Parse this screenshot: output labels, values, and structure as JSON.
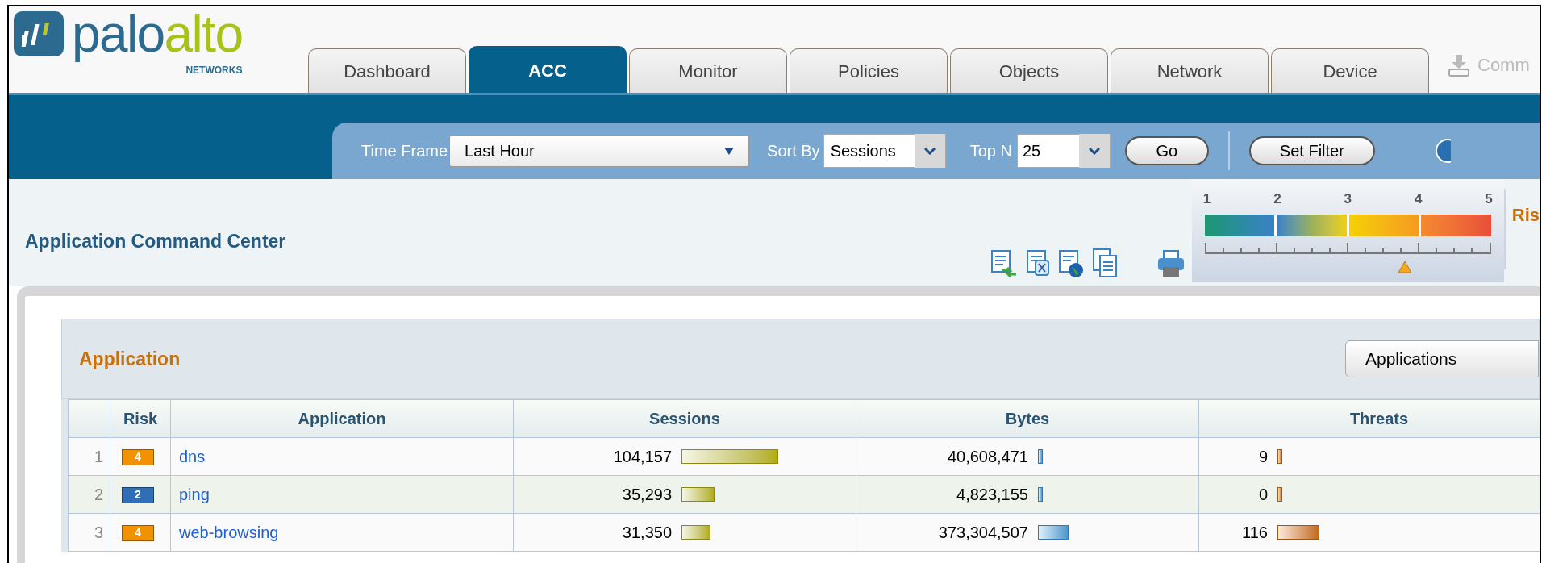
{
  "logo": {
    "word_1": "palo",
    "word_2": "alto",
    "subtitle": "NETWORKS"
  },
  "tabs": [
    {
      "label": "Dashboard",
      "selected": false
    },
    {
      "label": "ACC",
      "selected": true
    },
    {
      "label": "Monitor",
      "selected": false
    },
    {
      "label": "Policies",
      "selected": false
    },
    {
      "label": "Objects",
      "selected": false
    },
    {
      "label": "Network",
      "selected": false
    },
    {
      "label": "Device",
      "selected": false
    }
  ],
  "commit": {
    "label": "Comm"
  },
  "filters": {
    "time_frame": {
      "label": "Time Frame",
      "value": "Last Hour"
    },
    "sort_by": {
      "label": "Sort By",
      "value": "Sessions"
    },
    "top_n": {
      "label": "Top N",
      "value": "25"
    }
  },
  "buttons": [
    "Go",
    "Set Filter"
  ],
  "page_title": "Application Command Center",
  "risk_meter": {
    "labels": [
      "1",
      "2",
      "3",
      "4",
      "5"
    ],
    "level": 0.7,
    "title": "Ris"
  },
  "panel": {
    "title": "Application",
    "selector": "Applications",
    "columns": [
      "Risk",
      "Application",
      "Sessions",
      "Bytes",
      "Threats"
    ],
    "rows": [
      {
        "index": "1",
        "risk": {
          "value": "4",
          "color": "#f39200"
        },
        "application": "dns",
        "sessions": "104,157",
        "bytes": "40,608,471",
        "threats": "9"
      },
      {
        "index": "2",
        "risk": {
          "value": "2",
          "color": "#2f6fb7"
        },
        "application": "ping",
        "sessions": "35,293",
        "bytes": "4,823,155",
        "threats": "0"
      },
      {
        "index": "3",
        "risk": {
          "value": "4",
          "color": "#f39200"
        },
        "application": "web-browsing",
        "sessions": "31,350",
        "bytes": "373,304,507",
        "threats": "116"
      }
    ]
  }
}
